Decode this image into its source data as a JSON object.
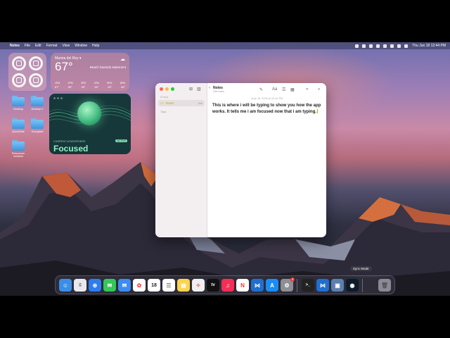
{
  "menubar": {
    "app_name": "Notes",
    "menus": [
      "File",
      "Edit",
      "Format",
      "View",
      "Window",
      "Help"
    ],
    "clock": "Thu Jun 18  12:44 PM"
  },
  "widgets": {
    "weather": {
      "city": "Marina del Rey ▾",
      "temperature": "67°",
      "note": "Beach hazards statement",
      "hours": [
        "1PM",
        "2PM",
        "3PM",
        "4PM",
        "5PM",
        "6PM"
      ],
      "temps": [
        "67°",
        "69°",
        "69°",
        "69°",
        "69°",
        "66°"
      ]
    },
    "focus": {
      "caption": "CURRENT ATMOSPHERE",
      "badge": "ACTIVE",
      "title": "Focused"
    }
  },
  "desktop": {
    "folders": [
      {
        "label": "Desktop"
      },
      {
        "label": "Desktop 2"
      },
      {
        "label": "QuickNote"
      },
      {
        "label": "Sourglass"
      },
      {
        "label": "Resources versions"
      }
    ]
  },
  "notes": {
    "sidebar_section_top": "iCloud",
    "folder_label": "Notes",
    "folder_count": "246",
    "sidebar_section_tags": "Tags",
    "header_title": "Notes",
    "header_subtitle": "246 notes",
    "date": "June 18, 2026 at 12:44 PM",
    "body": "This is where i will be typing to show you how the app works. It tells me i am focused now that i am typing."
  },
  "dock": {
    "tooltip": "Sync Mode",
    "calendar_day": "18",
    "settings_badge": "3"
  }
}
